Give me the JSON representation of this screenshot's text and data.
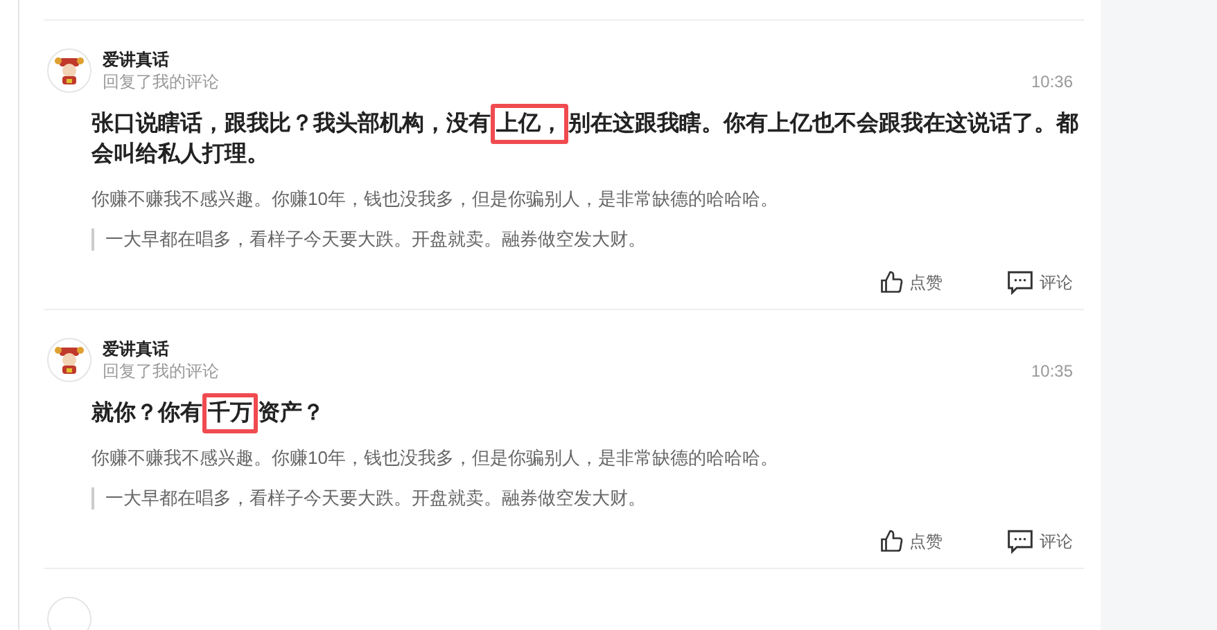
{
  "comments": [
    {
      "author": "爱讲真话",
      "action": "回复了我的评论",
      "time": "10:36",
      "reply": [
        {
          "text": "张口说瞎话，跟我比？我头部机构，没有",
          "highlighted": false
        },
        {
          "text": "上亿，",
          "highlighted": true
        },
        {
          "text": "别在这跟我瞎。你有上亿也不会跟我在这说话了。都会叫给私人打理。",
          "highlighted": false
        }
      ],
      "my_comment": "你赚不赚我不感兴趣。你赚10年，钱也没我多，但是你骗别人，是非常缺德的哈哈哈。",
      "quoted": "一大早都在唱多，看样子今天要大跌。开盘就卖。融券做空发大财。",
      "actions": [
        {
          "kind": "like",
          "label": "点赞"
        },
        {
          "kind": "comment",
          "label": "评论"
        }
      ]
    },
    {
      "author": "爱讲真话",
      "action": "回复了我的评论",
      "time": "10:35",
      "reply": [
        {
          "text": "就你？你有",
          "highlighted": false
        },
        {
          "text": "千万",
          "highlighted": true
        },
        {
          "text": "资产？",
          "highlighted": false
        }
      ],
      "my_comment": "你赚不赚我不感兴趣。你赚10年，钱也没我多，但是你骗别人，是非常缺德的哈哈哈。",
      "quoted": "一大早都在唱多，看样子今天要大跌。开盘就卖。融券做空发大财。",
      "actions": [
        {
          "kind": "like",
          "label": "点赞"
        },
        {
          "kind": "comment",
          "label": "评论"
        }
      ]
    }
  ]
}
